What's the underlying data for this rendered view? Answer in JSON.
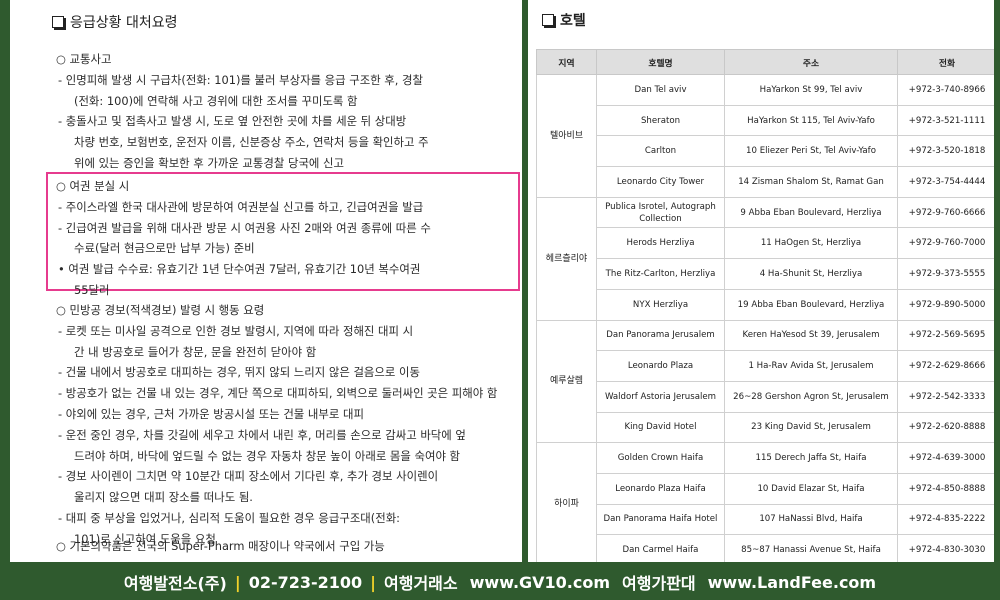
{
  "left": {
    "title": "응급상황 대처요령",
    "traffic": {
      "lines": [
        "○ 교통사고",
        "- 인명피해 발생 시 구급차(전화: 101)를 불러 부상자를 응급 구조한 후, 경찰",
        "(전화: 100)에 연락해 사고 경위에 대한 조서를 꾸미도록 함",
        "- 충돌사고 및 접촉사고 발생 시, 도로 옆 안전한 곳에 차를 세운 뒤 상대방",
        "차량 번호, 보험번호, 운전자 이름, 신분증상 주소, 연락처 등을 확인하고 주",
        "위에 있는 증인을 확보한 후 가까운 교통경찰 당국에 신고"
      ]
    },
    "passport": {
      "lines": [
        "○ 여권 분실 시",
        "- 주이스라엘 한국 대사관에 방문하여 여권분실 신고를 하고, 긴급여권을 발급",
        "- 긴급여권 발급을 위해 대사관 방문 시 여권용 사진 2매와 여권 종류에 따른 수",
        "수료(달러 현금으로만 납부 가능) 준비",
        "• 여권 발급 수수료: 유효기간 1년 단수여권 7달러, 유효기간 10년 복수여권",
        "55달러"
      ]
    },
    "air_raid": {
      "lines": [
        "○ 민방공 경보(적색경보) 발령 시 행동 요령",
        "- 로켓 또는 미사일 공격으로 인한 경보 발령시, 지역에 따라 정해진 대피 시",
        "간 내 방공호로 들어가 창문, 문을 완전히 닫아야 함",
        "- 건물 내에서 방공호로 대피하는 경우, 뛰지 않되 느리지 않은 걸음으로 이동",
        "- 방공호가 없는 건물 내 있는 경우, 계단 쪽으로 대피하되, 외벽으로 둘러싸인 곳은 피해야 함",
        "- 야외에 있는 경우, 근처 가까운 방공시설 또는 건물 내부로 대피",
        "- 운전 중인 경우, 차를 갓길에 세우고 차에서 내린 후, 머리를 손으로 감싸고 바닥에 엎",
        "드려야 하며, 바닥에 엎드릴 수 없는 경우 자동차 창문 높이 아래로 몸을 숙여야 함",
        "- 경보 사이렌이 그치면 약 10분간 대피 장소에서 기다린 후, 추가 경보 사이렌이",
        "울리지 않으면 대피 장소를 떠나도 됨.",
        "- 대피 중 부상을 입었거나, 심리적 도움이 필요한 경우 응급구조대(전화:",
        "101)로 신고하여 도움을 요청"
      ]
    },
    "medicine": {
      "lines": [
        "○ 기본의약품은 전국의 Super-Pharm 매장이나 약국에서 구입 가능"
      ]
    }
  },
  "right": {
    "title": "호텔",
    "table": {
      "headers": [
        "지역",
        "호텔명",
        "주소",
        "전화"
      ],
      "regions": [
        {
          "name": "텔아비브",
          "rows": [
            [
              "Dan Tel aviv",
              "HaYarkon St 99, Tel aviv",
              "+972-3-740-8966"
            ],
            [
              "Sheraton",
              "HaYarkon St 115, Tel Aviv-Yafo",
              "+972-3-521-1111"
            ],
            [
              "Carlton",
              "10 Eliezer Peri St, Tel Aviv-Yafo",
              "+972-3-520-1818"
            ],
            [
              "Leonardo City Tower",
              "14 Zisman Shalom St, Ramat Gan",
              "+972-3-754-4444"
            ]
          ]
        },
        {
          "name": "헤르츨리야",
          "rows": [
            [
              "Publica Isrotel, Autograph Collection",
              "9 Abba Eban Boulevard, Herzliya",
              "+972-9-760-6666"
            ],
            [
              "Herods Herzliya",
              "11 HaOgen St, Herzliya",
              "+972-9-760-7000"
            ],
            [
              "The Ritz-Carlton, Herzliya",
              "4 Ha-Shunit St, Herzliya",
              "+972-9-373-5555"
            ],
            [
              "NYX Herzliya",
              "19 Abba Eban Boulevard, Herzliya",
              "+972-9-890-5000"
            ]
          ]
        },
        {
          "name": "예루살렘",
          "rows": [
            [
              "Dan Panorama Jerusalem",
              "Keren HaYesod St 39, Jerusalem",
              "+972-2-569-5695"
            ],
            [
              "Leonardo Plaza",
              "1 Ha-Rav Avida St, Jerusalem",
              "+972-2-629-8666"
            ],
            [
              "Waldorf Astoria Jerusalem",
              "26~28 Gershon Agron St, Jerusalem",
              "+972-2-542-3333"
            ],
            [
              "King David Hotel",
              "23 King David St, Jerusalem",
              "+972-2-620-8888"
            ]
          ]
        },
        {
          "name": "하이파",
          "rows": [
            [
              "Golden Crown Haifa",
              "115 Derech Jaffa St, Haifa",
              "+972-4-639-3000"
            ],
            [
              "Leonardo Plaza Haifa",
              "10 David Elazar St, Haifa",
              "+972-4-850-8888"
            ],
            [
              "Dan Panorama Haifa Hotel",
              "107 HaNassi Blvd, Haifa",
              "+972-4-835-2222"
            ],
            [
              "Dan Carmel Haifa",
              "85~87 Hanassi Avenue St, Haifa",
              "+972-4-830-3030"
            ]
          ]
        }
      ]
    }
  },
  "footer": {
    "company": "여행발전소(주)",
    "phone": "02-723-2100",
    "exchange_label": "여행거래소",
    "exchange_url": "www.GV10.com",
    "sale_label": "여행가판대",
    "sale_url": "www.LandFee.com"
  },
  "colors": {
    "background": "#2f5a2e",
    "highlight": "#e63b8e",
    "separator": "#f2d22a",
    "table_header": "#dfdfdf"
  }
}
